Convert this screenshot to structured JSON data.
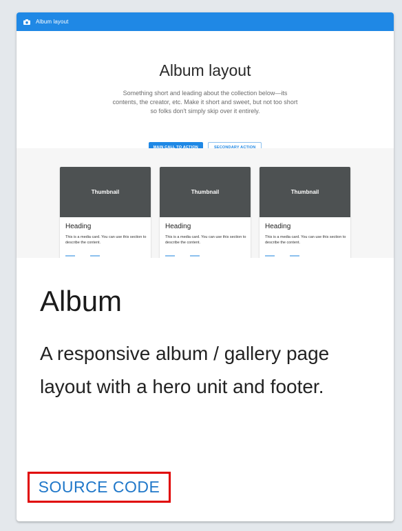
{
  "preview": {
    "appbar_title": "Album layout",
    "hero_title": "Album layout",
    "hero_description": "Something short and leading about the collection below—its contents, the creator, etc. Make it short and sweet, but not too short so folks don't simply skip over it entirely.",
    "primary_action": "MAIN CALL TO ACTION",
    "secondary_action": "SECONDARY ACTION",
    "cards": [
      {
        "thumbnail": "Thumbnail",
        "heading": "Heading",
        "text": "This is a media card. You can use this section to describe the content."
      },
      {
        "thumbnail": "Thumbnail",
        "heading": "Heading",
        "text": "This is a media card. You can use this section to describe the content."
      },
      {
        "thumbnail": "Thumbnail",
        "heading": "Heading",
        "text": "This is a media card. You can use this section to describe the content."
      }
    ]
  },
  "card": {
    "title": "Album",
    "description": "A responsive album / gallery page layout with a hero unit and footer.",
    "source_label": "SOURCE CODE"
  },
  "colors": {
    "primary": "#1f88e5",
    "link": "#1f77c9",
    "highlight": "#e00000",
    "thumbnail": "#4d5152"
  },
  "icons": {
    "appbar": "camera-icon"
  }
}
